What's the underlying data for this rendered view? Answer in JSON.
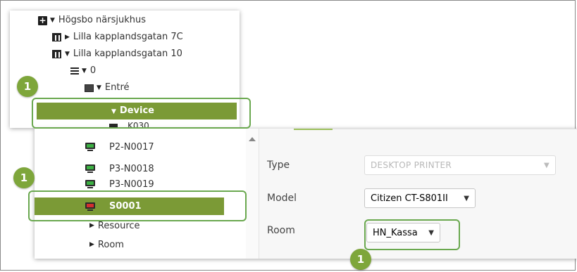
{
  "tree": {
    "hospital": "Högsbo närsjukhus",
    "building1": "Lilla kapplandsgatan 7C",
    "building2": "Lilla kapplandsgatan 10",
    "floor": "0",
    "room": "Entré",
    "device_folder": "Device",
    "partial_item": "K030"
  },
  "device_list": {
    "items": [
      "P2-N0017",
      "P3-N0018",
      "P3-N0019"
    ],
    "selected": "S0001",
    "sub_folders": [
      "Resource",
      "Room"
    ]
  },
  "form": {
    "type_label": "Type",
    "type_value": "DESKTOP PRINTER",
    "model_label": "Model",
    "model_value": "Citizen CT-S801II",
    "room_label": "Room",
    "room_value": "HN_Kassa"
  },
  "callouts": {
    "badge_tree": "1",
    "badge_list": "1",
    "badge_room": "1"
  },
  "colors": {
    "selection": "#7b9a36",
    "callout": "#6aa84f"
  }
}
